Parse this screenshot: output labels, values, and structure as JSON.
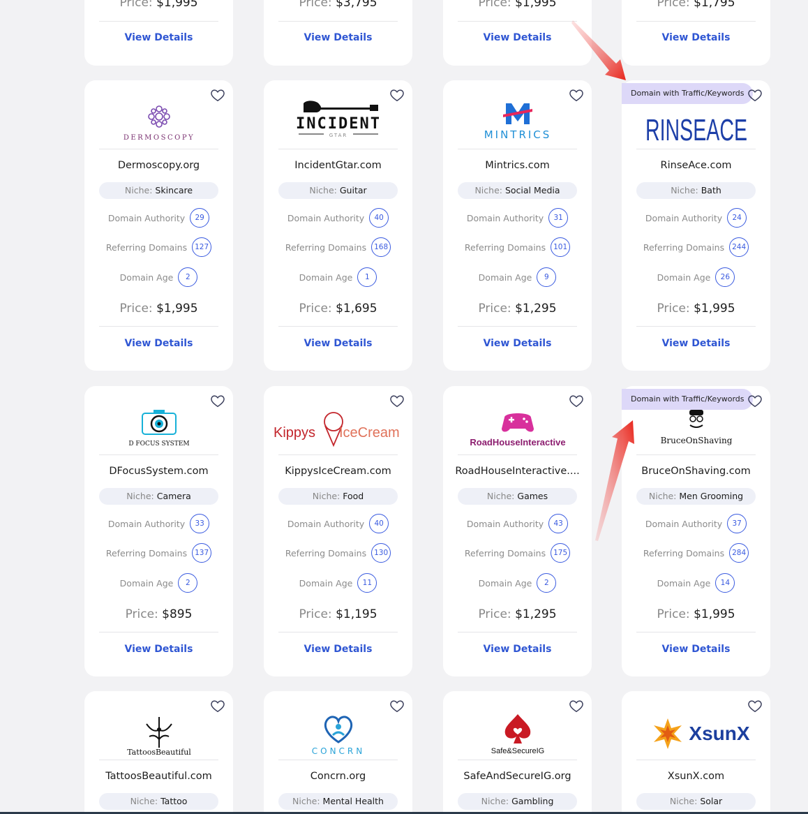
{
  "top_row": [
    {
      "price_label": "Price:",
      "price": "$1,995",
      "details": "View Details"
    },
    {
      "price_label": "Price:",
      "price": "$3,795",
      "details": "View Details"
    },
    {
      "price_label": "Price:",
      "price": "$1,995",
      "details": "View Details"
    },
    {
      "price_label": "Price:",
      "price": "$1,795",
      "details": "View Details"
    }
  ],
  "labels": {
    "niche": "Niche:",
    "domain_authority": "Domain Authority",
    "referring_domains": "Referring Domains",
    "domain_age": "Domain Age",
    "price": "Price:",
    "view_details": "View Details",
    "traffic_badge": "Domain with Traffic/Keywords"
  },
  "cards": [
    {
      "name": "Dermoscopy.org",
      "niche": "Skincare",
      "da": "29",
      "rd": "127",
      "age": "2",
      "price": "$1,995",
      "logo_text": "DERMOSCOPY",
      "badge": false
    },
    {
      "name": "IncidentGtar.com",
      "niche": "Guitar",
      "da": "40",
      "rd": "168",
      "age": "1",
      "price": "$1,695",
      "logo_text": "INCIDENT",
      "logo_sub": "GTAR",
      "badge": false
    },
    {
      "name": "Mintrics.com",
      "niche": "Social Media",
      "da": "31",
      "rd": "101",
      "age": "9",
      "price": "$1,295",
      "logo_text": "MINTRICS",
      "badge": false
    },
    {
      "name": "RinseAce.com",
      "niche": "Bath",
      "da": "24",
      "rd": "244",
      "age": "26",
      "price": "$1,995",
      "logo_text": "RINSEACE",
      "badge": true
    },
    {
      "name": "DFocusSystem.com",
      "niche": "Camera",
      "da": "33",
      "rd": "137",
      "age": "2",
      "price": "$895",
      "logo_text": "D FOCUS SYSTEM",
      "badge": false
    },
    {
      "name": "KippysIceCream.com",
      "niche": "Food",
      "da": "40",
      "rd": "130",
      "age": "11",
      "price": "$1,195",
      "logo_text": "Kippys",
      "logo_text2": "IceCream",
      "badge": false
    },
    {
      "name": "RoadHouseInteractive....",
      "niche": "Games",
      "da": "43",
      "rd": "175",
      "age": "2",
      "price": "$1,295",
      "logo_text": "RoadHouseInteractive",
      "badge": false
    },
    {
      "name": "BruceOnShaving.com",
      "niche": "Men Grooming",
      "da": "37",
      "rd": "284",
      "age": "14",
      "price": "$1,995",
      "logo_text": "BruceOnShaving",
      "badge": true
    },
    {
      "name": "TattoosBeautiful.com",
      "niche": "Tattoo",
      "logo_text": "TattoosBeautiful",
      "badge": false
    },
    {
      "name": "Concrn.org",
      "niche": "Mental Health",
      "logo_text": "CONCRN",
      "badge": false
    },
    {
      "name": "SafeAndSecureIG.org",
      "niche": "Gambling",
      "logo_text": "Safe&SecureIG",
      "badge": false
    },
    {
      "name": "XsunX.com",
      "niche": "Solar",
      "logo_text": "XsunX",
      "badge": false
    }
  ],
  "colors": {
    "link": "#2f56d3",
    "circle": "#3a5be0",
    "badge_bg": "#ddd8f8",
    "arrow": "#e8261c"
  }
}
